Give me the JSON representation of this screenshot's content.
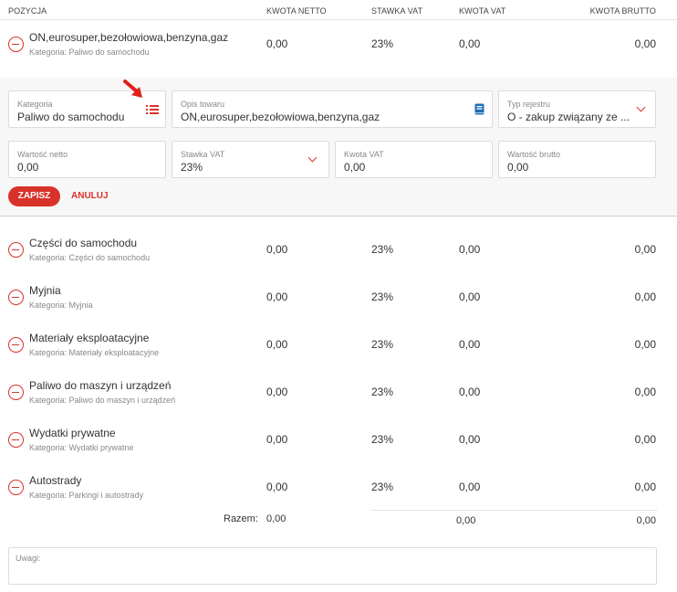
{
  "header": {
    "position": "POZYCJA",
    "net_amount": "KWOTA NETTO",
    "vat_rate": "STAWKA VAT",
    "vat_amount": "KWOTA VAT",
    "gross_amount": "KWOTA BRUTTO"
  },
  "active_item": {
    "name": "ON,eurosuper,bezołowiowa,benzyna,gaz",
    "category": "Kategoria: Paliwo do samochodu",
    "net": "0,00",
    "vat_rate": "23%",
    "vat": "0,00",
    "gross": "0,00"
  },
  "edit_form": {
    "category": {
      "label": "Kategoria",
      "value": "Paliwo do samochodu",
      "icon": "list-icon"
    },
    "description": {
      "label": "Opis towaru",
      "value": "ON,eurosuper,bezołowiowa,benzyna,gaz",
      "icon": "book-icon"
    },
    "register_type": {
      "label": "Typ rejestru",
      "value": "O - zakup związany ze ..."
    },
    "net_value": {
      "label": "Wartość netto",
      "value": "0,00"
    },
    "vat_rate": {
      "label": "Stawka VAT",
      "value": "23%"
    },
    "vat_amount": {
      "label": "Kwota VAT",
      "value": "0,00"
    },
    "gross_value": {
      "label": "Wartość brutto",
      "value": "0,00"
    },
    "save_label": "ZAPISZ",
    "cancel_label": "ANULUJ"
  },
  "items": [
    {
      "name": "Części do samochodu",
      "category": "Kategoria: Części do samochodu",
      "net": "0,00",
      "vat_rate": "23%",
      "vat": "0,00",
      "gross": "0,00"
    },
    {
      "name": "Myjnia",
      "category": "Kategoria: Myjnia",
      "net": "0,00",
      "vat_rate": "23%",
      "vat": "0,00",
      "gross": "0,00"
    },
    {
      "name": "Materiały eksploatacyjne",
      "category": "Kategoria: Materiały eksploatacyjne",
      "net": "0,00",
      "vat_rate": "23%",
      "vat": "0,00",
      "gross": "0,00"
    },
    {
      "name": "Paliwo do maszyn i urządzeń",
      "category": "Kategoria: Paliwo do maszyn i urządzeń",
      "net": "0,00",
      "vat_rate": "23%",
      "vat": "0,00",
      "gross": "0,00"
    },
    {
      "name": "Wydatki prywatne",
      "category": "Kategoria: Wydatki prywatne",
      "net": "0,00",
      "vat_rate": "23%",
      "vat": "0,00",
      "gross": "0,00"
    },
    {
      "name": "Autostrady",
      "category": "Kategoria: Parkingi i autostrady",
      "net": "0,00",
      "vat_rate": "23%",
      "vat": "0,00",
      "gross": "0,00"
    }
  ],
  "summary": {
    "label": "Razem:",
    "net": "0,00",
    "vat": "0,00",
    "gross": "0,00"
  },
  "notes": {
    "label": "Uwagi:"
  },
  "colors": {
    "accent": "#d9322a",
    "book_icon": "#1c6fb5"
  }
}
